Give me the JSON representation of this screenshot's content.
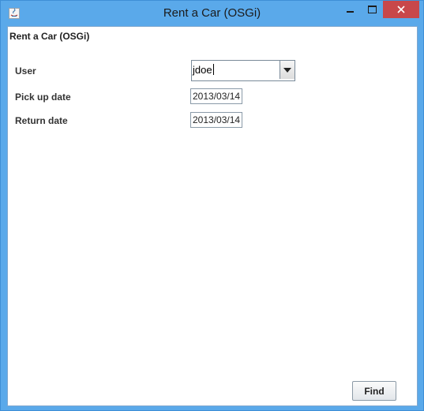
{
  "window": {
    "title": "Rent a Car (OSGi)",
    "icon": "java-coffee-icon",
    "controls": {
      "minimize": "minimize-icon",
      "maximize": "maximize-icon",
      "close": "close-icon"
    }
  },
  "panel": {
    "header": "Rent a Car (OSGi)"
  },
  "form": {
    "user_label": "User",
    "user_value": "jdoe",
    "pickup_label": "Pick up date",
    "pickup_value": "2013/03/14",
    "return_label": "Return date",
    "return_value": "2013/03/14"
  },
  "actions": {
    "find_label": "Find"
  },
  "colors": {
    "frame": "#5aa9ea",
    "close": "#c8474a",
    "content_bg": "#ffffff"
  }
}
